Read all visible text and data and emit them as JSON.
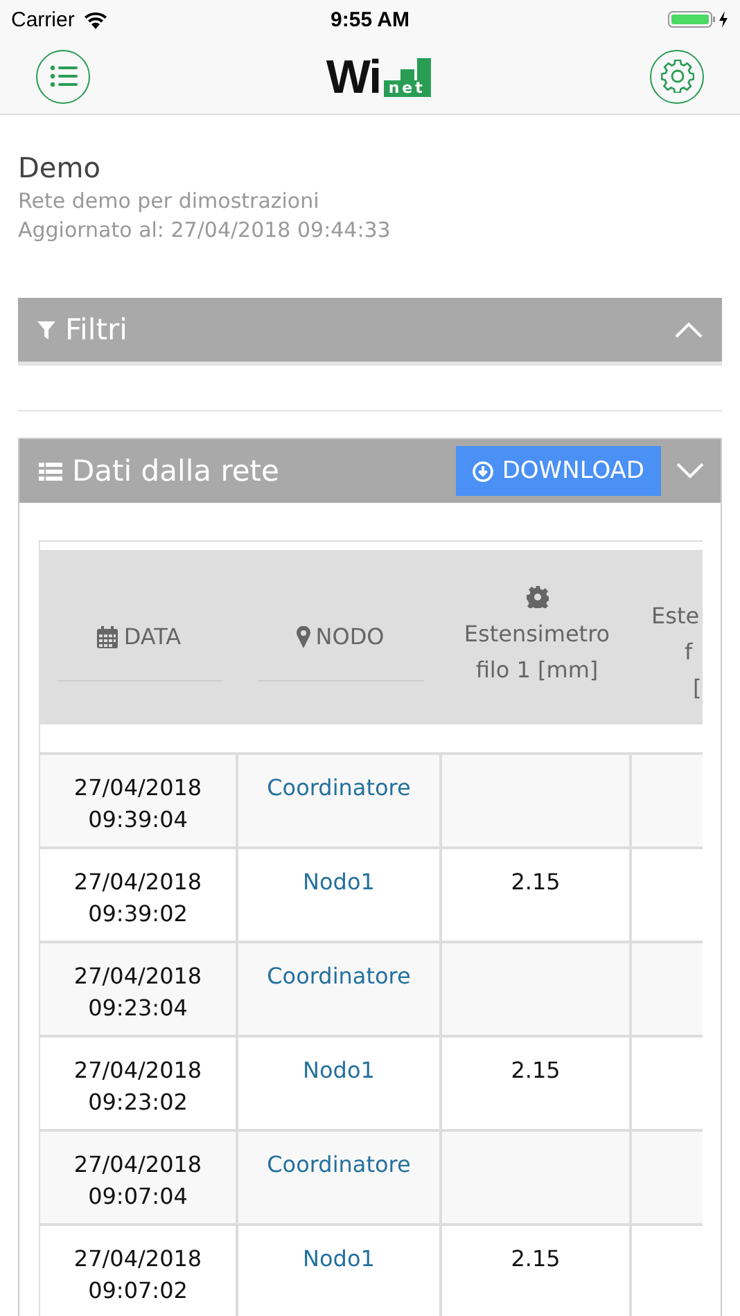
{
  "status_bar": {
    "carrier": "Carrier",
    "time": "9:55 AM"
  },
  "nav": {
    "logo_main": "Wi",
    "logo_sub": "net"
  },
  "network": {
    "name": "Demo",
    "description": "Rete demo per dimostrazioni",
    "updated": "Aggiornato al: 27/04/2018 09:44:33"
  },
  "filters": {
    "title": "Filtri",
    "expanded": true
  },
  "data_panel": {
    "title": "Dati dalla rete",
    "download": "DOWNLOAD",
    "expanded": false
  },
  "table": {
    "columns": [
      {
        "kind": "date",
        "lines": [
          "DATA"
        ]
      },
      {
        "kind": "node",
        "lines": [
          "NODO"
        ]
      },
      {
        "kind": "sensor",
        "lines": [
          "Estensimetro",
          "filo 1",
          "[mm]"
        ]
      },
      {
        "kind": "cut",
        "lines": [
          "Este",
          "f",
          "["
        ]
      }
    ],
    "rows": [
      {
        "date": "27/04/2018",
        "time": "09:39:04",
        "node": "Coordinatore",
        "value": ""
      },
      {
        "date": "27/04/2018",
        "time": "09:39:02",
        "node": "Nodo1",
        "value": "2.15"
      },
      {
        "date": "27/04/2018",
        "time": "09:23:04",
        "node": "Coordinatore",
        "value": ""
      },
      {
        "date": "27/04/2018",
        "time": "09:23:02",
        "node": "Nodo1",
        "value": "2.15"
      },
      {
        "date": "27/04/2018",
        "time": "09:07:04",
        "node": "Coordinatore",
        "value": ""
      },
      {
        "date": "27/04/2018",
        "time": "09:07:02",
        "node": "Nodo1",
        "value": "2.15"
      }
    ]
  }
}
